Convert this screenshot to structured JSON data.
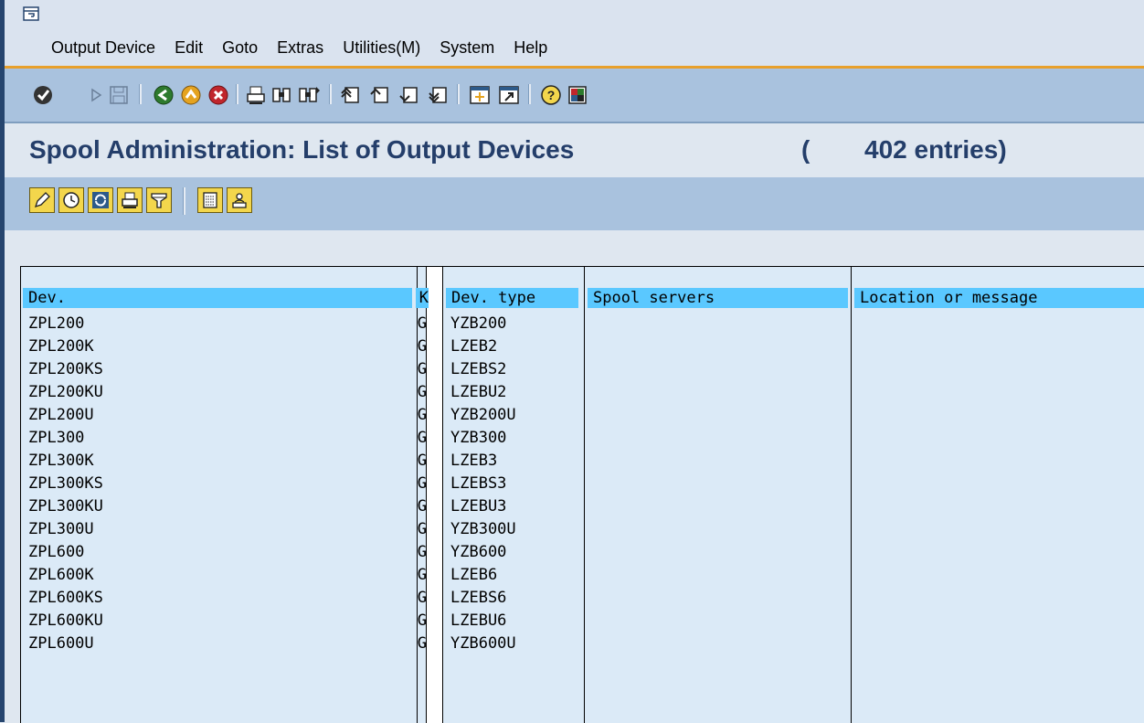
{
  "menu": {
    "items": [
      "Output Device",
      "Edit",
      "Goto",
      "Extras",
      "Utilities(M)",
      "System",
      "Help"
    ]
  },
  "toolbar_icons": [
    "enter-icon",
    "back-triangle-icon",
    "save-icon",
    "back-icon",
    "exit-icon",
    "cancel-icon",
    "print-icon",
    "find-icon",
    "find-next-icon",
    "first-page-icon",
    "previous-page-icon",
    "next-page-icon",
    "last-page-icon",
    "create-session-icon",
    "shortcut-icon",
    "help-icon",
    "layout-icon"
  ],
  "title": {
    "text": "Spool Administration: List of Output Devices",
    "paren": "(",
    "count": "402 entries)"
  },
  "app_toolbar_icons": [
    "change-pencil-icon",
    "schedule-clock-icon",
    "refresh-icon",
    "print-icon",
    "filter-icon",
    "spreadsheet-icon",
    "printer-person-icon"
  ],
  "list": {
    "headers": [
      "Dev.",
      "K",
      "Dev. type",
      "Spool servers",
      "Location or message"
    ],
    "rows": [
      {
        "dev": "ZPL200",
        "k": "G",
        "type": "YZB200"
      },
      {
        "dev": "ZPL200K",
        "k": "G",
        "type": "LZEB2"
      },
      {
        "dev": "ZPL200KS",
        "k": "G",
        "type": "LZEBS2"
      },
      {
        "dev": "ZPL200KU",
        "k": "G",
        "type": "LZEBU2"
      },
      {
        "dev": "ZPL200U",
        "k": "G",
        "type": "YZB200U"
      },
      {
        "dev": "ZPL300",
        "k": "G",
        "type": "YZB300"
      },
      {
        "dev": "ZPL300K",
        "k": "G",
        "type": "LZEB3"
      },
      {
        "dev": "ZPL300KS",
        "k": "G",
        "type": "LZEBS3"
      },
      {
        "dev": "ZPL300KU",
        "k": "G",
        "type": "LZEBU3"
      },
      {
        "dev": "ZPL300U",
        "k": "G",
        "type": "YZB300U"
      },
      {
        "dev": "ZPL600",
        "k": "G",
        "type": "YZB600"
      },
      {
        "dev": "ZPL600K",
        "k": "G",
        "type": "LZEB6"
      },
      {
        "dev": "ZPL600KS",
        "k": "G",
        "type": "LZEBS6"
      },
      {
        "dev": "ZPL600KU",
        "k": "G",
        "type": "LZEBU6"
      },
      {
        "dev": "ZPL600U",
        "k": "G",
        "type": "YZB600U"
      }
    ]
  },
  "colors": {
    "header_highlight": "#5ac8ff",
    "title": "#243e6a",
    "toolbar": "#a9c2de",
    "accent_line": "#e8a02b"
  }
}
